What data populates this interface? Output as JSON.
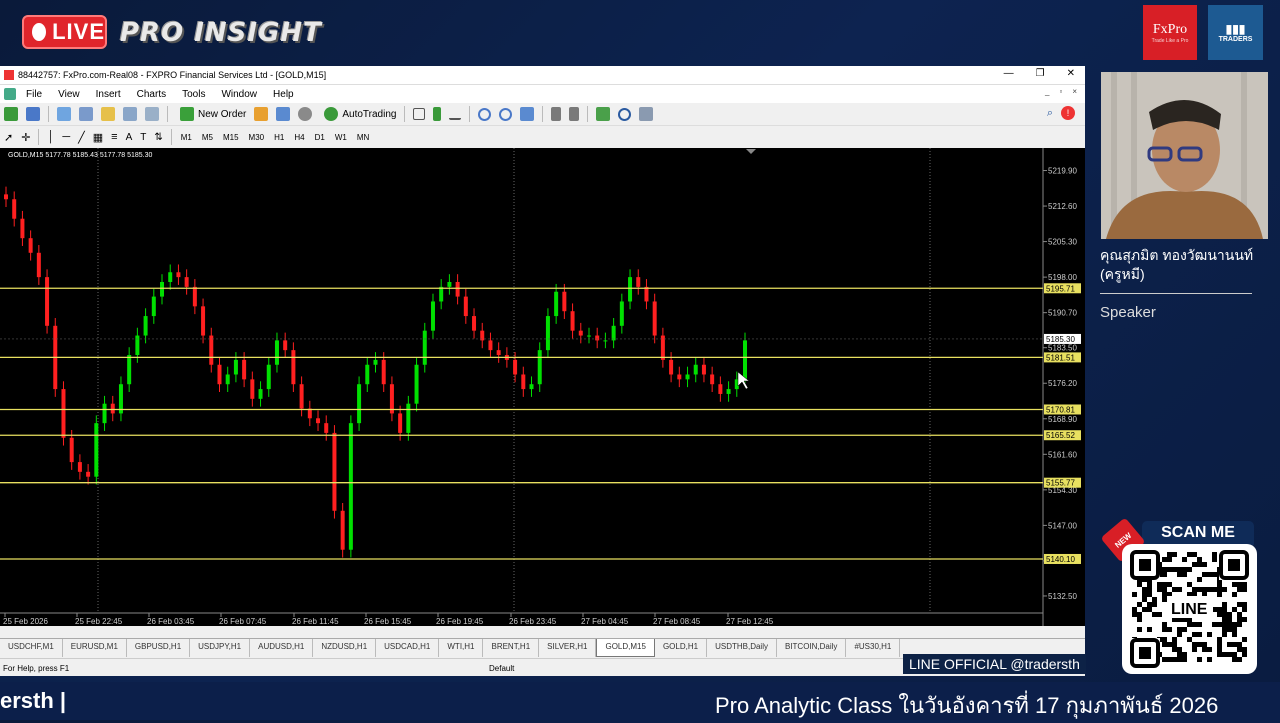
{
  "banner": {
    "live_label": "LIVE",
    "title": "PRO INSIGHT",
    "logo1_name": "FxPro",
    "logo1_tagline": "Trade Like a Pro",
    "logo2_name": "TRADERS"
  },
  "window": {
    "title": "88442757: FxPro.com-Real08 - FXPRO Financial Services Ltd - [GOLD,M15]"
  },
  "menu": [
    "File",
    "View",
    "Insert",
    "Charts",
    "Tools",
    "Window",
    "Help"
  ],
  "toolbar": {
    "new_order": "New Order",
    "autotrading": "AutoTrading",
    "timeframes": [
      "M1",
      "M5",
      "M15",
      "M30",
      "H1",
      "H4",
      "D1",
      "W1",
      "MN"
    ]
  },
  "chart": {
    "info": "GOLD,M15  5177.78 5185.43 5177.78 5185.30",
    "colors": {
      "up": "#00e000",
      "down": "#ff2020",
      "level": "#e8e060",
      "bg": "#000000"
    }
  },
  "chart_data": {
    "type": "candlestick",
    "symbol": "GOLD",
    "timeframe": "M15",
    "y_ticks": [
      "5219.90",
      "5212.60",
      "5205.30",
      "5198.00",
      "5190.70",
      "5183.50",
      "5176.20",
      "5168.90",
      "5161.60",
      "5154.30",
      "5147.00",
      "5139.70",
      "5132.50"
    ],
    "ylim": [
      5129.0,
      5223.5
    ],
    "x_ticks": [
      "25 Feb 2026",
      "25 Feb 22:45",
      "26 Feb 03:45",
      "26 Feb 07:45",
      "26 Feb 11:45",
      "26 Feb 15:45",
      "26 Feb 19:45",
      "26 Feb 23:45",
      "27 Feb 04:45",
      "27 Feb 08:45",
      "27 Feb 12:45"
    ],
    "levels": [
      {
        "label": "5195.71",
        "value": 5195.71
      },
      {
        "label": "5181.51",
        "value": 5181.51
      },
      {
        "label": "5170.81",
        "value": 5170.81
      },
      {
        "label": "5165.52",
        "value": 5165.52
      },
      {
        "label": "5155.77",
        "value": 5155.77
      },
      {
        "label": "5140.10",
        "value": 5140.1
      }
    ],
    "current_price": {
      "label": "5185.30",
      "value": 5185.3
    },
    "close_path": [
      5214,
      5210,
      5206,
      5203,
      5198,
      5188,
      5175,
      5165,
      5160,
      5158,
      5157,
      5168,
      5172,
      5170,
      5176,
      5182,
      5186,
      5190,
      5194,
      5197,
      5199,
      5198,
      5196,
      5192,
      5186,
      5180,
      5176,
      5178,
      5181,
      5177,
      5173,
      5175,
      5180,
      5185,
      5183,
      5176,
      5171,
      5169,
      5168,
      5166,
      5150,
      5142,
      5168,
      5176,
      5180,
      5181,
      5176,
      5170,
      5166,
      5172,
      5180,
      5187,
      5193,
      5196,
      5197,
      5194,
      5190,
      5187,
      5185,
      5183,
      5182,
      5181,
      5178,
      5175,
      5176,
      5183,
      5190,
      5195,
      5191,
      5187,
      5186,
      5186,
      5185,
      5185,
      5188,
      5193,
      5198,
      5196,
      5193,
      5186,
      5181,
      5178,
      5177,
      5178,
      5180,
      5178,
      5176,
      5174,
      5175,
      5177,
      5185
    ]
  },
  "tabs": [
    "USDCHF,M1",
    "EURUSD,M1",
    "GBPUSD,H1",
    "USDJPY,H1",
    "AUDUSD,H1",
    "NZDUSD,H1",
    "USDCAD,H1",
    "WTI,H1",
    "BRENT,H1",
    "SILVER,H1",
    "GOLD,M15",
    "GOLD,H1",
    "USDTHB,Daily",
    "BITCOIN,Daily",
    "#US30,H1"
  ],
  "active_tab": "GOLD,M15",
  "status": {
    "help": "For Help, press F1",
    "profile": "Default"
  },
  "speaker": {
    "name": "คุณสุภมิต ทองวัฒนานนท์ (ครูหมี)",
    "role": "Speaker"
  },
  "qr": {
    "scan": "SCAN ME",
    "new": "NEW",
    "center": "LINE",
    "line_official": "LINE OFFICIAL @tradersth"
  },
  "ticker": {
    "left": "ersth |",
    "right": "Pro Analytic Class ในวันอังคารที่ 17 กุมภาพันธ์ 2026"
  }
}
